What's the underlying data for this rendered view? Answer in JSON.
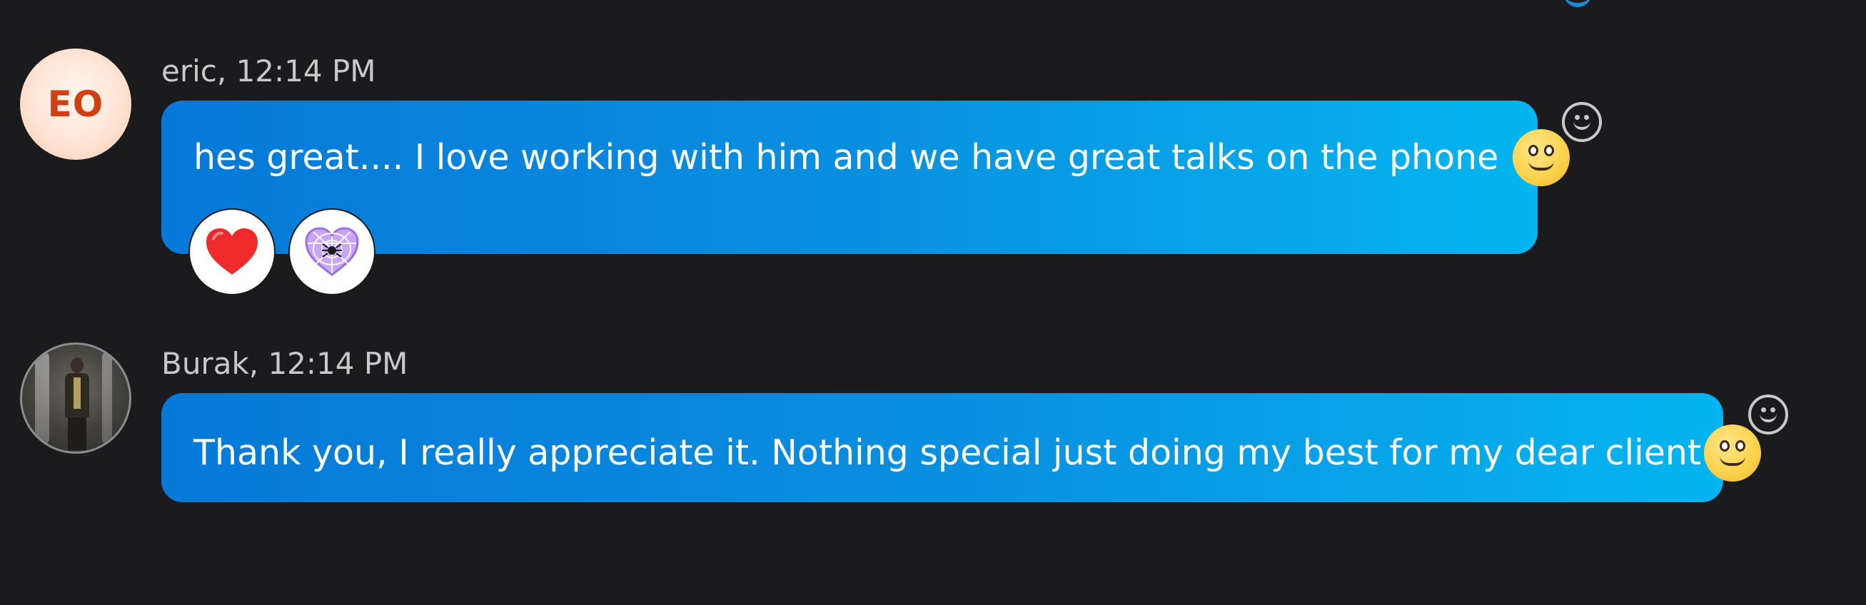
{
  "messages": [
    {
      "avatar": {
        "initials": "EO",
        "initials_color": "#d23f12"
      },
      "sender_time": "eric, 12:14 PM",
      "text": "hes great.... I love working with him and we have great talks on the phone",
      "inline_emoji": "slightly-smiling-face-icon",
      "reactions": [
        {
          "icon": "red-heart-icon",
          "color": "#ee2a2a"
        },
        {
          "icon": "spider-web-heart-icon",
          "color": "#b48cf2"
        }
      ]
    },
    {
      "avatar": {
        "type": "photo"
      },
      "sender_time": "Burak, 12:14 PM",
      "text": "Thank you, I really appreciate it. Nothing special just doing my best for my dear client",
      "inline_emoji": "slightly-smiling-face-icon"
    }
  ],
  "colors": {
    "background": "#1b1b1d",
    "bubble_gradient_start": "#0679d8",
    "bubble_gradient_end": "#04b5ef",
    "meta_text": "#c9c9c9"
  }
}
